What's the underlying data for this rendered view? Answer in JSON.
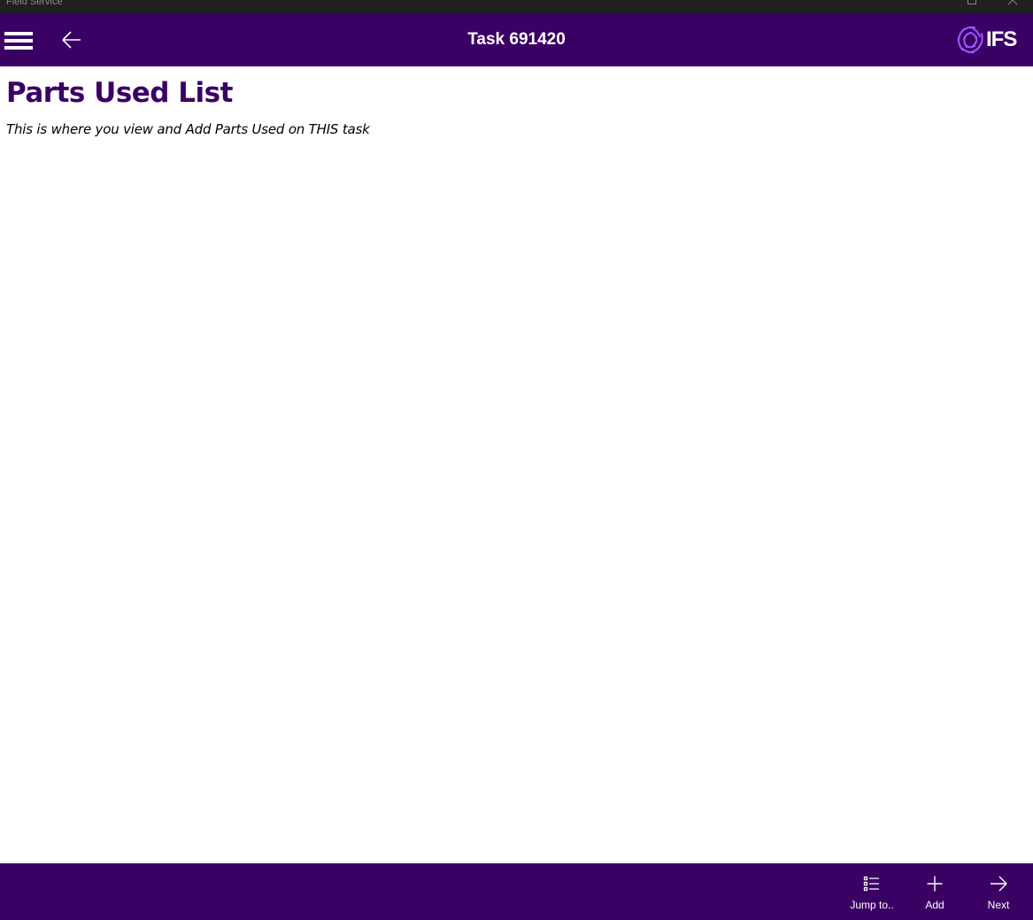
{
  "window": {
    "title": "Field Service"
  },
  "header": {
    "title": "Task 691420",
    "menu_icon": "hamburger-menu-icon",
    "back_icon": "back-arrow-icon",
    "logo_text": "IFS"
  },
  "page": {
    "title": "Parts Used List",
    "subtitle": "This is where you view and Add Parts Used on THIS task"
  },
  "commands": [
    {
      "label": "Jump to..",
      "icon": "list-icon"
    },
    {
      "label": "Add",
      "icon": "plus-icon"
    },
    {
      "label": "Next",
      "icon": "arrow-right-icon"
    }
  ],
  "colors": {
    "brand": "#3b0064",
    "titlebar": "#202020",
    "logo_accent": "#9b59ff"
  }
}
